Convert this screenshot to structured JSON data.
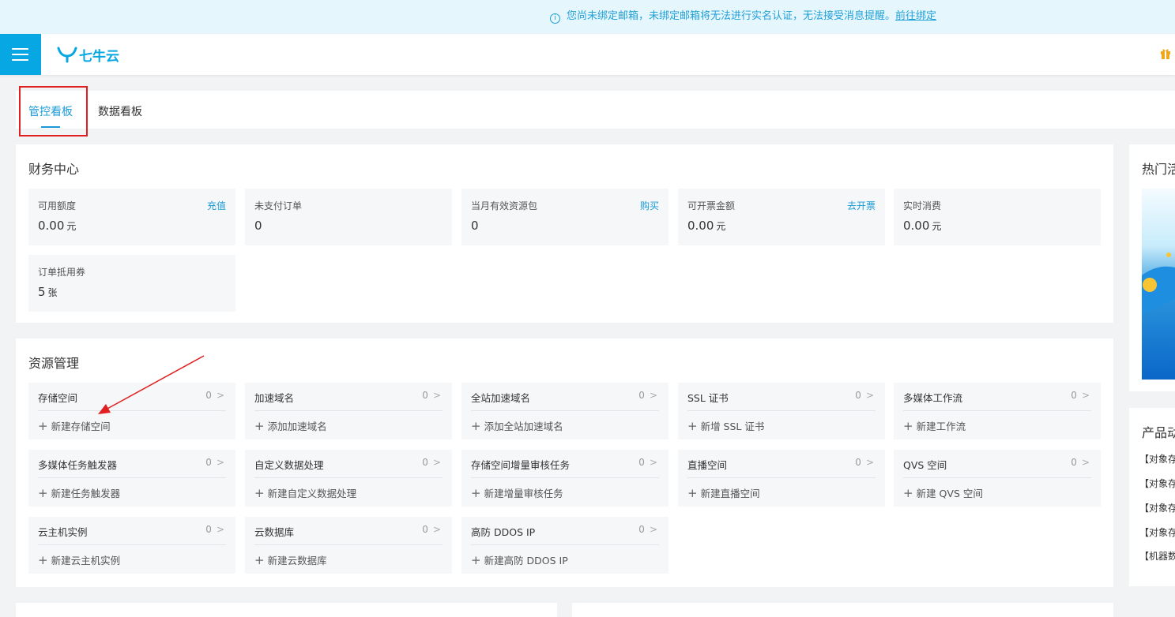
{
  "notice": {
    "text": "您尚未绑定邮箱，未绑定邮箱将无法进行实名认证，无法接受消息提醒。",
    "link": "前往绑定",
    "info_glyph": "i"
  },
  "brand": {
    "logo_text": "七牛云",
    "accent": "#06a7e2"
  },
  "tabs": [
    {
      "label": "管控看板",
      "active": true
    },
    {
      "label": "数据看板",
      "active": false
    }
  ],
  "finance": {
    "title": "财务中心",
    "cards": [
      {
        "label": "可用额度",
        "action": "充值",
        "value": "0.00",
        "unit": "元"
      },
      {
        "label": "未支付订单",
        "action": "",
        "value": "0",
        "unit": ""
      },
      {
        "label": "当月有效资源包",
        "action": "购买",
        "value": "0",
        "unit": ""
      },
      {
        "label": "可开票金额",
        "action": "去开票",
        "value": "0.00",
        "unit": "元"
      },
      {
        "label": "实时消费",
        "action": "",
        "value": "0.00",
        "unit": "元"
      },
      {
        "label": "订单抵用券",
        "action": "",
        "value": "5",
        "unit": "张"
      }
    ]
  },
  "resources": {
    "title": "资源管理",
    "cards": [
      {
        "name": "存储空间",
        "count": "0",
        "add": "新建存储空间"
      },
      {
        "name": "加速域名",
        "count": "0",
        "add": "添加加速域名"
      },
      {
        "name": "全站加速域名",
        "count": "0",
        "add": "添加全站加速域名"
      },
      {
        "name": "SSL 证书",
        "count": "0",
        "add": "新增 SSL 证书"
      },
      {
        "name": "多媒体工作流",
        "count": "0",
        "add": "新建工作流"
      },
      {
        "name": "多媒体任务触发器",
        "count": "0",
        "add": "新建任务触发器"
      },
      {
        "name": "自定义数据处理",
        "count": "0",
        "add": "新建自定义数据处理"
      },
      {
        "name": "存储空间增量审核任务",
        "count": "0",
        "add": "新建增量审核任务"
      },
      {
        "name": "直播空间",
        "count": "0",
        "add": "新建直播空间"
      },
      {
        "name": "QVS 空间",
        "count": "0",
        "add": "新建 QVS 空间"
      },
      {
        "name": "云主机实例",
        "count": "0",
        "add": "新建云主机实例"
      },
      {
        "name": "云数据库",
        "count": "0",
        "add": "新建云数据库"
      },
      {
        "name": "高防 DDOS IP",
        "count": "0",
        "add": "新建高防 DDOS IP"
      }
    ]
  },
  "side": {
    "hot_title": "热门活",
    "news_title": "产品动",
    "news": [
      "【对象存",
      "【对象存",
      "【对象存",
      "【对象存",
      "【机器数"
    ]
  }
}
